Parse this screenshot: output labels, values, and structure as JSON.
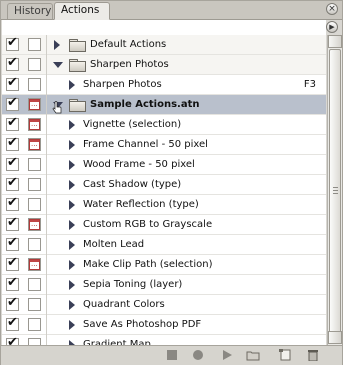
{
  "tabs": [
    {
      "label": "History",
      "active": false
    },
    {
      "label": "Actions",
      "active": true
    }
  ],
  "rows": [
    {
      "level": 0,
      "type": "set",
      "label": "Default Actions",
      "expanded": false,
      "checked": true,
      "dialog": false
    },
    {
      "level": 0,
      "type": "set",
      "label": "Sharpen Photos",
      "expanded": true,
      "checked": true,
      "dialog": false
    },
    {
      "level": 1,
      "type": "action",
      "label": "Sharpen Photos",
      "shortcut": "F3",
      "checked": true,
      "dialog": false
    },
    {
      "level": 0,
      "type": "set",
      "label": "Sample Actions.atn",
      "expanded": true,
      "checked": true,
      "dialog": true,
      "selected": true
    },
    {
      "level": 1,
      "type": "action",
      "label": "Vignette (selection)",
      "checked": true,
      "dialog": true
    },
    {
      "level": 1,
      "type": "action",
      "label": "Frame Channel - 50 pixel",
      "checked": true,
      "dialog": true
    },
    {
      "level": 1,
      "type": "action",
      "label": "Wood Frame - 50 pixel",
      "checked": true,
      "dialog": false
    },
    {
      "level": 1,
      "type": "action",
      "label": "Cast Shadow (type)",
      "checked": true,
      "dialog": false
    },
    {
      "level": 1,
      "type": "action",
      "label": "Water Reflection (type)",
      "checked": true,
      "dialog": false
    },
    {
      "level": 1,
      "type": "action",
      "label": "Custom RGB to Grayscale",
      "checked": true,
      "dialog": true
    },
    {
      "level": 1,
      "type": "action",
      "label": "Molten Lead",
      "checked": true,
      "dialog": false
    },
    {
      "level": 1,
      "type": "action",
      "label": "Make Clip Path (selection)",
      "checked": true,
      "dialog": true
    },
    {
      "level": 1,
      "type": "action",
      "label": "Sepia Toning (layer)",
      "checked": true,
      "dialog": false
    },
    {
      "level": 1,
      "type": "action",
      "label": "Quadrant Colors",
      "checked": true,
      "dialog": false
    },
    {
      "level": 1,
      "type": "action",
      "label": "Save As Photoshop PDF",
      "checked": true,
      "dialog": false
    },
    {
      "level": 1,
      "type": "action",
      "label": "Gradient Map",
      "checked": true,
      "dialog": false
    }
  ],
  "toolbar": {
    "buttons": [
      "stop-icon",
      "record-icon",
      "play-icon",
      "new-set-icon",
      "new-action-icon",
      "trash-icon"
    ]
  },
  "colors": {
    "selected_row": "#b9c0cc",
    "triangle": "#3a3f57",
    "dialog_toggle": "#c04646"
  }
}
